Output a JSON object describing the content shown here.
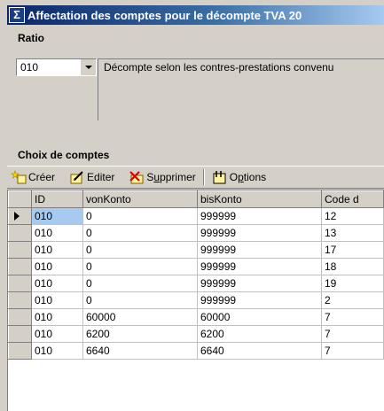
{
  "window": {
    "title": "Affectation des comptes pour le décompte TVA 20"
  },
  "ratio": {
    "label": "Ratio",
    "value": "010",
    "description": "Décompte selon les contres-prestations convenu"
  },
  "accounts": {
    "label": "Choix de comptes",
    "toolbar": {
      "create_label": "Créer",
      "edit_label": "Editer",
      "delete_prefix": "S",
      "delete_underline": "u",
      "delete_suffix": "pprimer",
      "options_prefix": "O",
      "options_underline": "p",
      "options_suffix": "tions"
    },
    "columns": [
      "ID",
      "vonKonto",
      "bisKonto",
      "Code d"
    ],
    "rows": [
      [
        "010",
        "0",
        "999999",
        "12"
      ],
      [
        "010",
        "0",
        "999999",
        "13"
      ],
      [
        "010",
        "0",
        "999999",
        "17"
      ],
      [
        "010",
        "0",
        "999999",
        "18"
      ],
      [
        "010",
        "0",
        "999999",
        "19"
      ],
      [
        "010",
        "0",
        "999999",
        "2"
      ],
      [
        "010",
        "60000",
        "60000",
        "7"
      ],
      [
        "010",
        "6200",
        "6200",
        "7"
      ],
      [
        "010",
        "6640",
        "6640",
        "7"
      ]
    ],
    "selected_row": 0
  }
}
